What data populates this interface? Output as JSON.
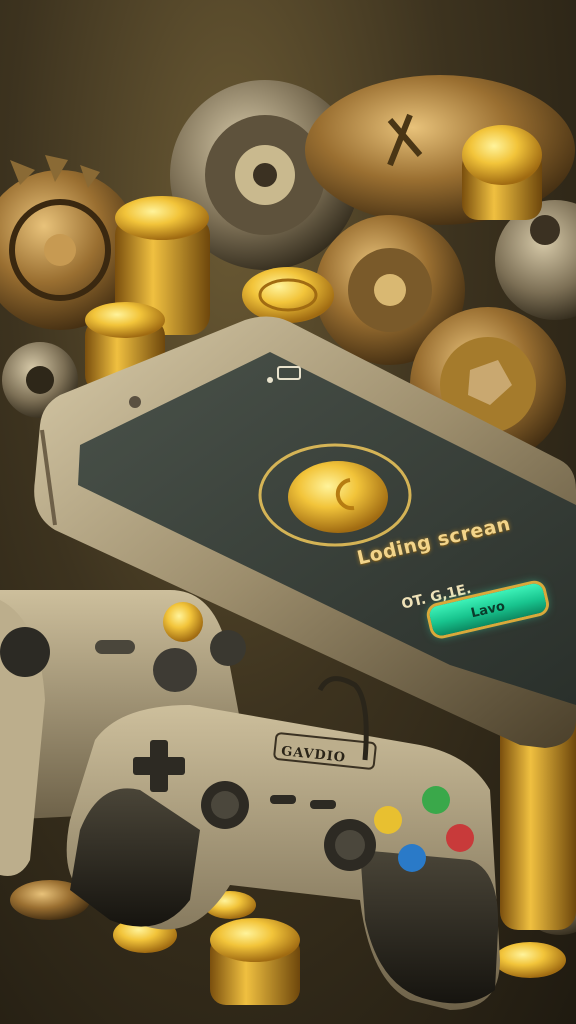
{
  "phone": {
    "loading_label": "Loding screan",
    "progress_label": "OT. G,1E.",
    "button_label": "Lavo"
  },
  "controller": {
    "brand_label": "GAVDIO"
  },
  "colors": {
    "gold": "#e8b830",
    "screen": "#3a413b",
    "button_green": "#22d49a",
    "background": "#3d331f"
  }
}
